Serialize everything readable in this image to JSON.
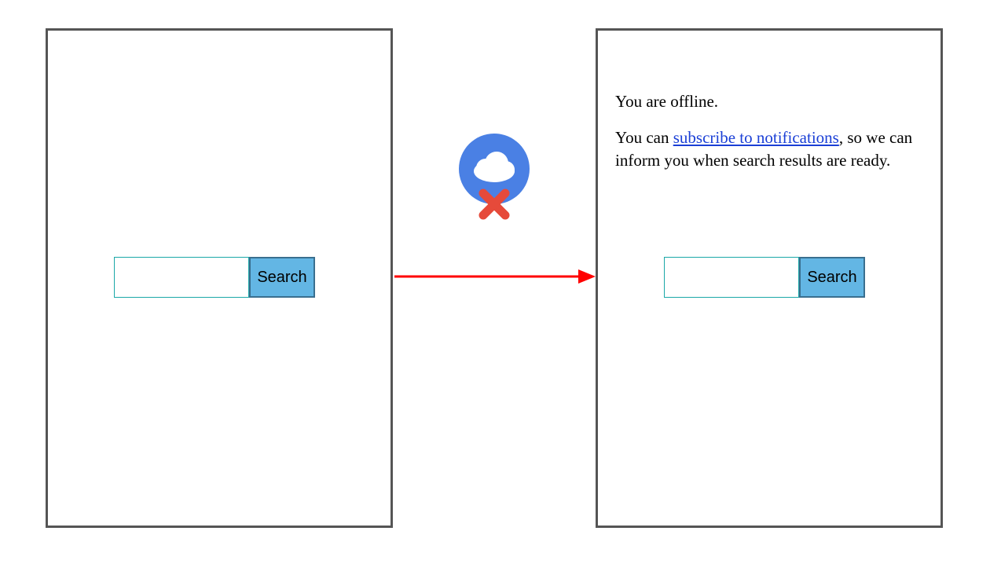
{
  "left": {
    "search": {
      "value": "",
      "button": "Search"
    }
  },
  "right": {
    "offline_text": "You are offline.",
    "hint_prefix": "You can ",
    "hint_link": "subscribe to notifications",
    "hint_suffix": ", so we can inform you when search results are ready.",
    "search": {
      "value": "",
      "button": "Search"
    }
  },
  "icons": {
    "offline": "cloud-offline-icon",
    "arrow": "arrow-right-icon"
  },
  "colors": {
    "panel_border": "#555555",
    "button_bg": "#63b6e4",
    "button_border": "#3a6f8f",
    "input_border": "#1aa7a7",
    "arrow": "#ff0000",
    "cloud_bg": "#4a80e4",
    "cross": "#e64a3a",
    "link": "#1a3fd6"
  }
}
